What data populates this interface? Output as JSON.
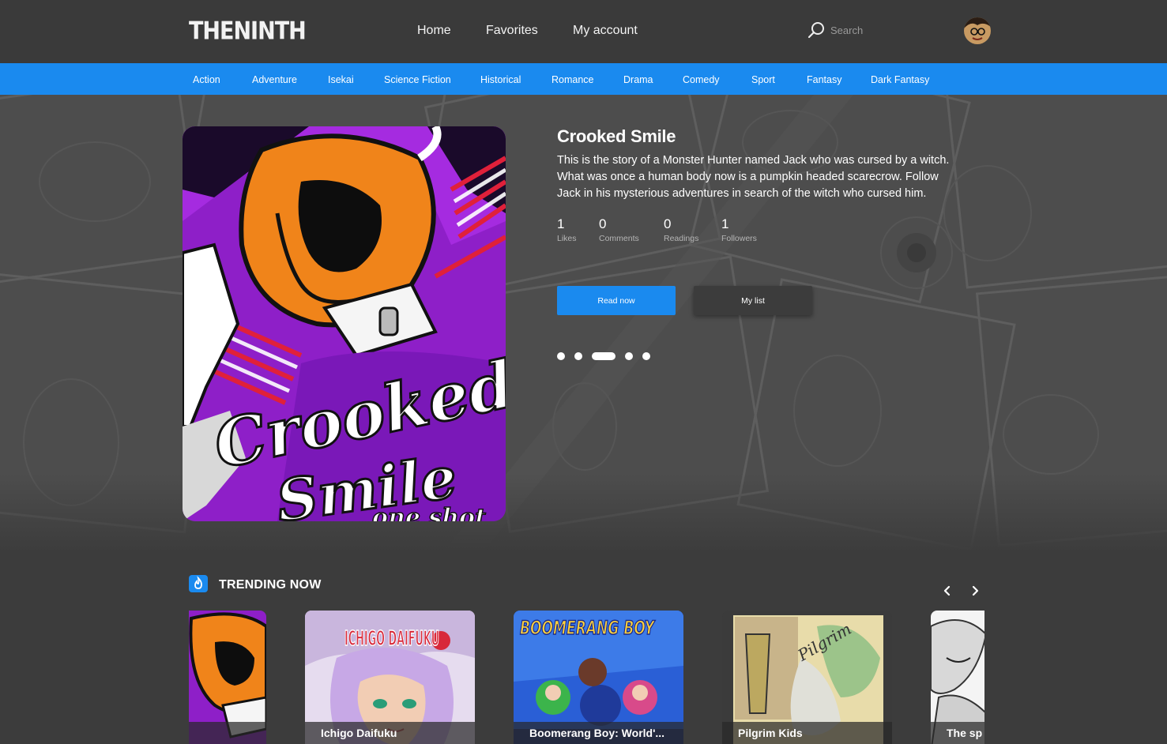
{
  "header": {
    "logo": "THENINTH",
    "nav": [
      "Home",
      "Favorites",
      "My account"
    ],
    "search_placeholder": "Search"
  },
  "genres": [
    "Action",
    "Adventure",
    "Isekai",
    "Science Fiction",
    "Historical",
    "Romance",
    "Drama",
    "Comedy",
    "Sport",
    "Fantasy",
    "Dark Fantasy"
  ],
  "featured": {
    "title": "Crooked Smile",
    "description": "This is the story of a Monster Hunter named Jack who was cursed by a witch. What was once a human body now is a pumpkin headed scarecrow. Follow Jack in his mysterious adventures in search of the witch who cursed him.",
    "cover_text": [
      "Crooked",
      "Smile",
      "one shot"
    ],
    "stats": [
      {
        "value": "1",
        "label": "Likes"
      },
      {
        "value": "0",
        "label": "Comments"
      },
      {
        "value": "0",
        "label": "Readings"
      },
      {
        "value": "1",
        "label": "Followers"
      }
    ],
    "read_label": "Read now",
    "list_label": "My list",
    "slide_count": 5,
    "active_slide": 3
  },
  "trending": {
    "title": "TRENDING NOW",
    "cards": [
      {
        "title": ""
      },
      {
        "title": "Ichigo Daifuku",
        "cover_text": "ICHIGO DAIFUKU"
      },
      {
        "title": "Boomerang Boy: World'...",
        "cover_text": "BOOMERANG BOY"
      },
      {
        "title": "Pilgrim Kids",
        "cover_text": "Pilgrim"
      },
      {
        "title": "The sp"
      }
    ]
  },
  "colors": {
    "accent": "#1a8aef",
    "header_bg": "#3a3a3a",
    "page_bg": "#3c3c3c"
  }
}
